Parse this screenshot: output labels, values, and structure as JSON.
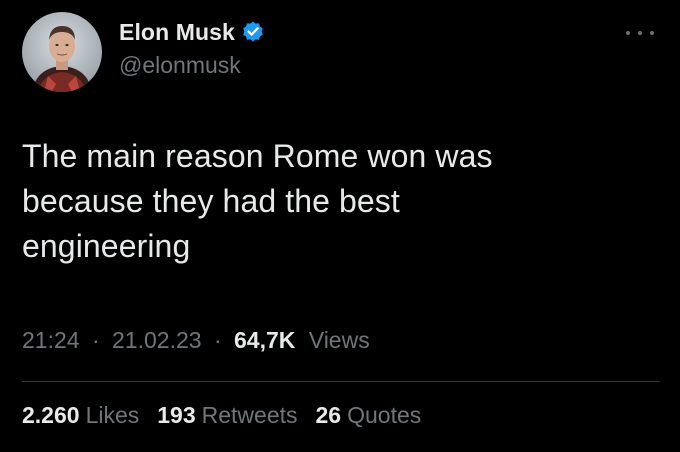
{
  "author": {
    "display_name": "Elon Musk",
    "handle": "@elonmusk",
    "verified_icon": "verified-badge-icon",
    "verified_color": "#1d9bf0"
  },
  "more_icon": "more-options-icon",
  "tweet": {
    "lines": [
      "The main reason Rome won was",
      "because they had the best",
      "engineering"
    ]
  },
  "meta": {
    "time": "21:24",
    "separator_1": "·",
    "date": "21.02.23",
    "separator_2": "·",
    "views_count": "64,7K",
    "views_label": "Views"
  },
  "stats": {
    "likes_count": "2.260",
    "likes_label": "Likes",
    "retweets_count": "193",
    "retweets_label": "Retweets",
    "quotes_count": "26",
    "quotes_label": "Quotes"
  },
  "colors": {
    "background": "#000000",
    "primary_text": "#e7e9ea",
    "secondary_text": "#71767b"
  }
}
